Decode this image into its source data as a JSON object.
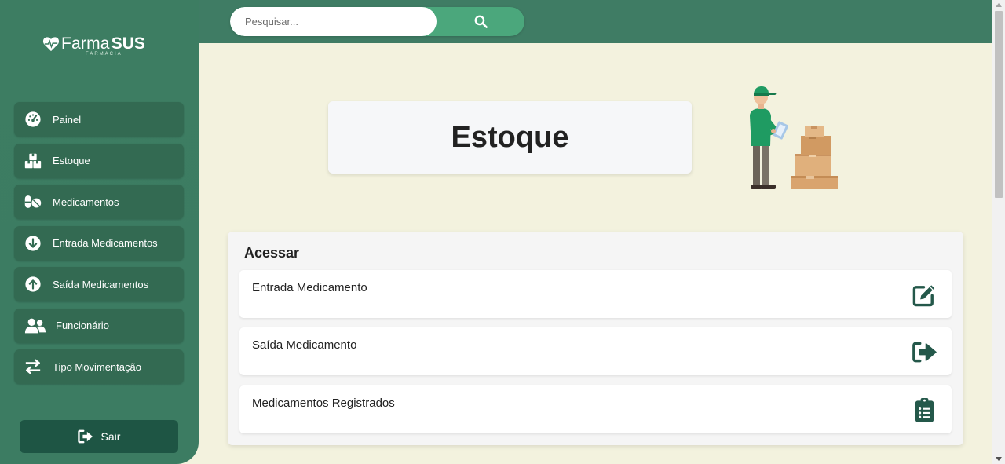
{
  "app": {
    "brand_main": "Farma",
    "brand_bold": "SUS",
    "brand_sub": "FARMACIA"
  },
  "search": {
    "placeholder": "Pesquisar..."
  },
  "sidebar": {
    "items": [
      {
        "label": "Painel",
        "icon": "gauge-icon"
      },
      {
        "label": "Estoque",
        "icon": "boxes-icon"
      },
      {
        "label": "Medicamentos",
        "icon": "pills-icon"
      },
      {
        "label": "Entrada Medicamentos",
        "icon": "arrow-circle-down-icon"
      },
      {
        "label": "Saída Medicamentos",
        "icon": "arrow-circle-up-icon"
      },
      {
        "label": "Funcionário",
        "icon": "users-icon"
      },
      {
        "label": "Tipo Movimentação",
        "icon": "exchange-icon"
      }
    ],
    "logout_label": "Sair"
  },
  "main": {
    "title": "Estoque",
    "panel_title": "Acessar",
    "access_items": [
      {
        "label": "Entrada Medicamento",
        "icon": "edit-icon"
      },
      {
        "label": "Saída Medicamento",
        "icon": "sign-out-icon"
      },
      {
        "label": "Medicamentos Registrados",
        "icon": "clipboard-list-icon"
      }
    ]
  },
  "colors": {
    "sidebar": "#3d7d62",
    "nav_item": "#336a52",
    "topbar": "#3f7c64",
    "search_button": "#4ba77c",
    "logout": "#1e5544",
    "background": "#f3f2de",
    "icon_dark": "#24584a"
  }
}
